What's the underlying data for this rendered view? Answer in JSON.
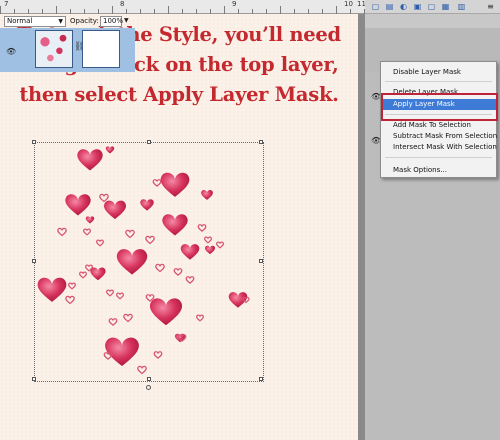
{
  "headline": {
    "line1": "To tweak the Style, you’ll need",
    "line2": "to right-click on the top layer,",
    "line3": "then select Apply Layer Mask."
  },
  "ruler": {
    "labels": [
      "7",
      "8",
      "9",
      "10",
      "11"
    ]
  },
  "layers_panel": {
    "blend_mode": "Normal",
    "opacity_label": "Opacity:",
    "opacity_value": "100%"
  },
  "context_menu": {
    "items": [
      "Disable Layer Mask",
      "Delete Layer Mask",
      "Apply Layer Mask",
      "Add Mask To Selection",
      "Subtract Mask From Selection",
      "Intersect Mask With Selection",
      "Mask Options..."
    ],
    "highlighted_item": "Apply Layer Mask"
  },
  "colors": {
    "headline": "#c4292f",
    "highlight": "#3d7bd6",
    "callout_box": "#c0223a",
    "heart_fill": "#d6325c",
    "heart_outline": "#e07a94",
    "canvas_bg": "#fbf1e8"
  },
  "icons": [
    "eye-icon",
    "link-icon",
    "new-layer-icon",
    "layer-style-icon",
    "delete-layer-icon",
    "panel-menu-icon"
  ]
}
